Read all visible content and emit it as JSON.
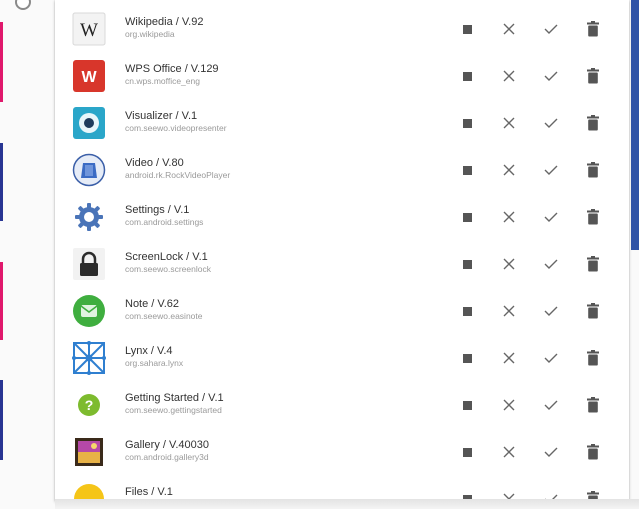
{
  "apps": [
    {
      "name": "Wikipedia / V.92",
      "package": "org.wikipedia",
      "icon": "wikipedia-icon"
    },
    {
      "name": "WPS Office / V.129",
      "package": "cn.wps.moffice_eng",
      "icon": "wps-office-icon"
    },
    {
      "name": "Visualizer / V.1",
      "package": "com.seewo.videopresenter",
      "icon": "visualizer-icon"
    },
    {
      "name": "Video / V.80",
      "package": "android.rk.RockVideoPlayer",
      "icon": "video-icon"
    },
    {
      "name": "Settings / V.1",
      "package": "com.android.settings",
      "icon": "settings-gear-icon"
    },
    {
      "name": "ScreenLock / V.1",
      "package": "com.seewo.screenlock",
      "icon": "lock-icon"
    },
    {
      "name": "Note / V.62",
      "package": "com.seewo.easinote",
      "icon": "note-icon"
    },
    {
      "name": "Lynx / V.4",
      "package": "org.sahara.lynx",
      "icon": "lynx-icon"
    },
    {
      "name": "Getting Started / V.1",
      "package": "com.seewo.gettingstarted",
      "icon": "help-icon"
    },
    {
      "name": "Gallery / V.40030",
      "package": "com.android.gallery3d",
      "icon": "gallery-icon"
    },
    {
      "name": "Files / V.1",
      "package": "",
      "icon": "files-icon"
    }
  ],
  "colors": {
    "accent_pink": "#e0186c",
    "accent_navy": "#283593",
    "scrollbar": "#2f52a6",
    "action_icons": "#555555"
  }
}
